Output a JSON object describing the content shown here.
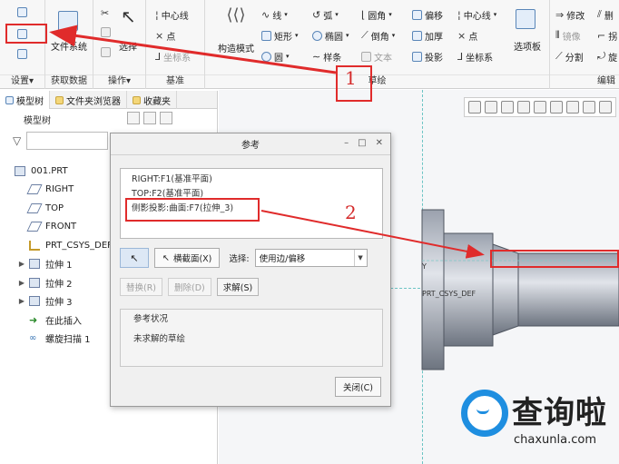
{
  "ribbon": {
    "groups": [
      {
        "label": "设置▾"
      },
      {
        "label": "获取数据"
      },
      {
        "label": "操作▾"
      },
      {
        "label": "基准"
      },
      {
        "label": "草绘"
      },
      {
        "label": "编辑"
      }
    ],
    "file_system_label": "文件系统",
    "select_label": "选择",
    "construction_label": "构造模式",
    "selection_palette_label": "选项板",
    "datum_items": [
      "中心线",
      "点",
      "坐标系"
    ],
    "sketch_items": [
      "线",
      "弧",
      "圆角",
      "偏移",
      "中心线",
      "矩形",
      "椭圆",
      "倒角",
      "加厚",
      "点",
      "圆",
      "样条",
      "文本",
      "投影",
      "坐标系"
    ],
    "edit_items": [
      "修改",
      "删",
      "镜像",
      "拐",
      "分割",
      "旋"
    ]
  },
  "left_panel": {
    "tabs": [
      "模型树",
      "文件夹浏览器",
      "收藏夹"
    ],
    "tree_header": "模型树",
    "tree_items": [
      {
        "label": "001.PRT",
        "icon": "part-icon",
        "expandable": false
      },
      {
        "label": "RIGHT",
        "icon": "datum-plane-icon",
        "expandable": false
      },
      {
        "label": "TOP",
        "icon": "datum-plane-icon",
        "expandable": false
      },
      {
        "label": "FRONT",
        "icon": "datum-plane-icon",
        "expandable": false
      },
      {
        "label": "PRT_CSYS_DEF",
        "icon": "csys-icon",
        "expandable": false
      },
      {
        "label": "拉伸 1",
        "icon": "extrude-icon",
        "expandable": true
      },
      {
        "label": "拉伸 2",
        "icon": "extrude-icon",
        "expandable": true
      },
      {
        "label": "拉伸 3",
        "icon": "extrude-icon",
        "expandable": true
      },
      {
        "label": "在此插入",
        "icon": "insert-here-icon",
        "expandable": false
      },
      {
        "label": "螺旋扫描 1",
        "icon": "helical-sweep-icon",
        "expandable": false
      }
    ]
  },
  "dialog": {
    "title": "参考",
    "references": [
      "RIGHT:F1(基准平面)",
      "TOP:F2(基准平面)",
      "侧影投影:曲面:F7(拉伸_3)"
    ],
    "section_button": "横截面(X)",
    "select_label": "选择:",
    "select_value": "使用边/偏移",
    "replace_button": "替换(R)",
    "delete_button": "删除(D)",
    "solve_button": "求解(S)",
    "status_header": "参考状况",
    "status_value": "未求解的草绘",
    "close_button": "关闭(C)"
  },
  "canvas": {
    "csys_label": "PRT_CSYS_DEF",
    "axis_label": "Y"
  },
  "annotations": {
    "callout_1": "1",
    "callout_2": "2",
    "color": "#e02b2b"
  },
  "watermark": {
    "brand": "查询啦",
    "url": "chaxunla.com"
  }
}
